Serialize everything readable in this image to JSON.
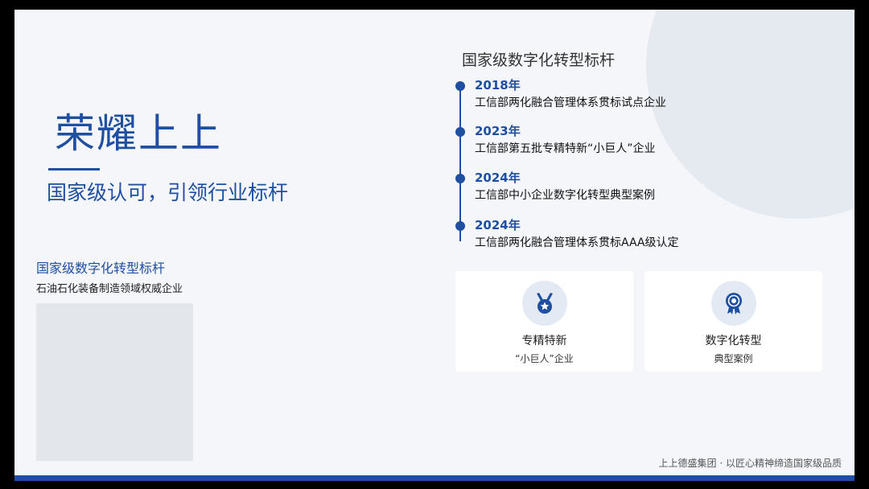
{
  "hero": {
    "title": "荣耀上上",
    "subtitle": "国家级认可，引领行业标杆"
  },
  "left_caption": {
    "title": "国家级数字化转型标杆",
    "subtitle": "石油石化装备制造领域权威企业"
  },
  "timeline": {
    "heading": "国家级数字化转型标杆",
    "items": [
      {
        "year": "2018年",
        "desc": "工信部两化融合管理体系贯标试点企业"
      },
      {
        "year": "2023年",
        "desc": "工信部第五批专精特新“小巨人”企业"
      },
      {
        "year": "2024年",
        "desc": "工信部中小企业数字化转型典型案例"
      },
      {
        "year": "2024年",
        "desc": "工信部两化融合管理体系贯标AAA级认定"
      }
    ]
  },
  "cards": [
    {
      "icon": "medal-icon",
      "title": "专精特新",
      "subtitle": "“小巨人”企业"
    },
    {
      "icon": "award-ribbon-icon",
      "title": "数字化转型",
      "subtitle": "典型案例"
    }
  ],
  "footer": {
    "text": "上上德盛集团 · 以匠心精神缔造国家级品质"
  },
  "colors": {
    "accent": "#1e4fa0",
    "background": "#f4f6fa",
    "icon_bg": "#e4eaf4"
  }
}
